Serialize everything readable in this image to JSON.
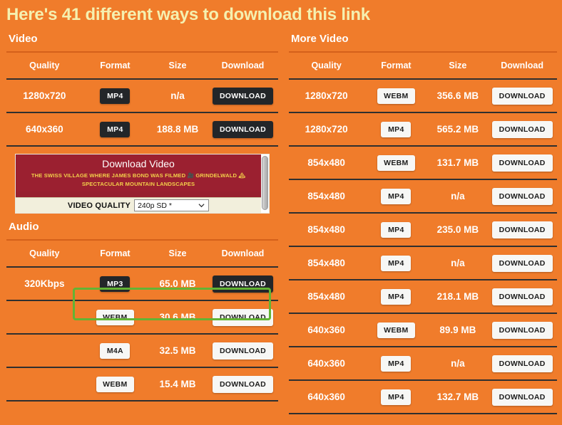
{
  "page": {
    "title": "Here's 41 different ways to download this link",
    "title_color": "#f5f0b0",
    "background_color": "#f07c2b"
  },
  "columns": {
    "headers": {
      "quality": "Quality",
      "format": "Format",
      "size": "Size",
      "download": "Download"
    },
    "download_label": "DOWNLOAD"
  },
  "sections": {
    "video": {
      "heading": "Video",
      "rows": [
        {
          "quality": "1280x720",
          "format": "MP4",
          "size": "n/a",
          "download": "DOWNLOAD",
          "style": "dark",
          "highlight": false
        },
        {
          "quality": "640x360",
          "format": "MP4",
          "size": "188.8 MB",
          "download": "DOWNLOAD",
          "style": "dark",
          "highlight": false
        }
      ]
    },
    "audio": {
      "heading": "Audio",
      "rows": [
        {
          "quality": "320Kbps",
          "format": "MP3",
          "size": "65.0 MB",
          "download": "DOWNLOAD",
          "style": "dark",
          "highlight": true
        },
        {
          "quality": "",
          "format": "WEBM",
          "size": "30.6 MB",
          "download": "DOWNLOAD",
          "style": "light",
          "highlight": false
        },
        {
          "quality": "",
          "format": "M4A",
          "size": "32.5 MB",
          "download": "DOWNLOAD",
          "style": "light",
          "highlight": false
        },
        {
          "quality": "",
          "format": "WEBM",
          "size": "15.4 MB",
          "download": "DOWNLOAD",
          "style": "light",
          "highlight": false
        }
      ]
    },
    "more_video": {
      "heading": "More Video",
      "rows": [
        {
          "quality": "1280x720",
          "format": "WEBM",
          "size": "356.6 MB",
          "download": "DOWNLOAD",
          "style": "light"
        },
        {
          "quality": "1280x720",
          "format": "MP4",
          "size": "565.2 MB",
          "download": "DOWNLOAD",
          "style": "light"
        },
        {
          "quality": "854x480",
          "format": "WEBM",
          "size": "131.7 MB",
          "download": "DOWNLOAD",
          "style": "light"
        },
        {
          "quality": "854x480",
          "format": "MP4",
          "size": "n/a",
          "download": "DOWNLOAD",
          "style": "light"
        },
        {
          "quality": "854x480",
          "format": "MP4",
          "size": "235.0 MB",
          "download": "DOWNLOAD",
          "style": "light"
        },
        {
          "quality": "854x480",
          "format": "MP4",
          "size": "n/a",
          "download": "DOWNLOAD",
          "style": "light"
        },
        {
          "quality": "854x480",
          "format": "MP4",
          "size": "218.1 MB",
          "download": "DOWNLOAD",
          "style": "light"
        },
        {
          "quality": "640x360",
          "format": "WEBM",
          "size": "89.9 MB",
          "download": "DOWNLOAD",
          "style": "light"
        },
        {
          "quality": "640x360",
          "format": "MP4",
          "size": "n/a",
          "download": "DOWNLOAD",
          "style": "light"
        },
        {
          "quality": "640x360",
          "format": "MP4",
          "size": "132.7 MB",
          "download": "DOWNLOAD",
          "style": "light"
        }
      ]
    }
  },
  "embed": {
    "title": "Download Video",
    "subtitle_line1": "THE SWISS VILLAGE WHERE JAMES BOND WAS FILMED 🎥 GRINDELWALD 🏔",
    "subtitle_line2": "SPECTACULAR MOUNTAIN LANDSCAPES",
    "quality_label": "VIDEO QUALITY",
    "quality_value": "240p SD *",
    "header_color": "#9b2030",
    "bar_color": "#f2efdc"
  },
  "highlight": {
    "color": "#63b434"
  }
}
